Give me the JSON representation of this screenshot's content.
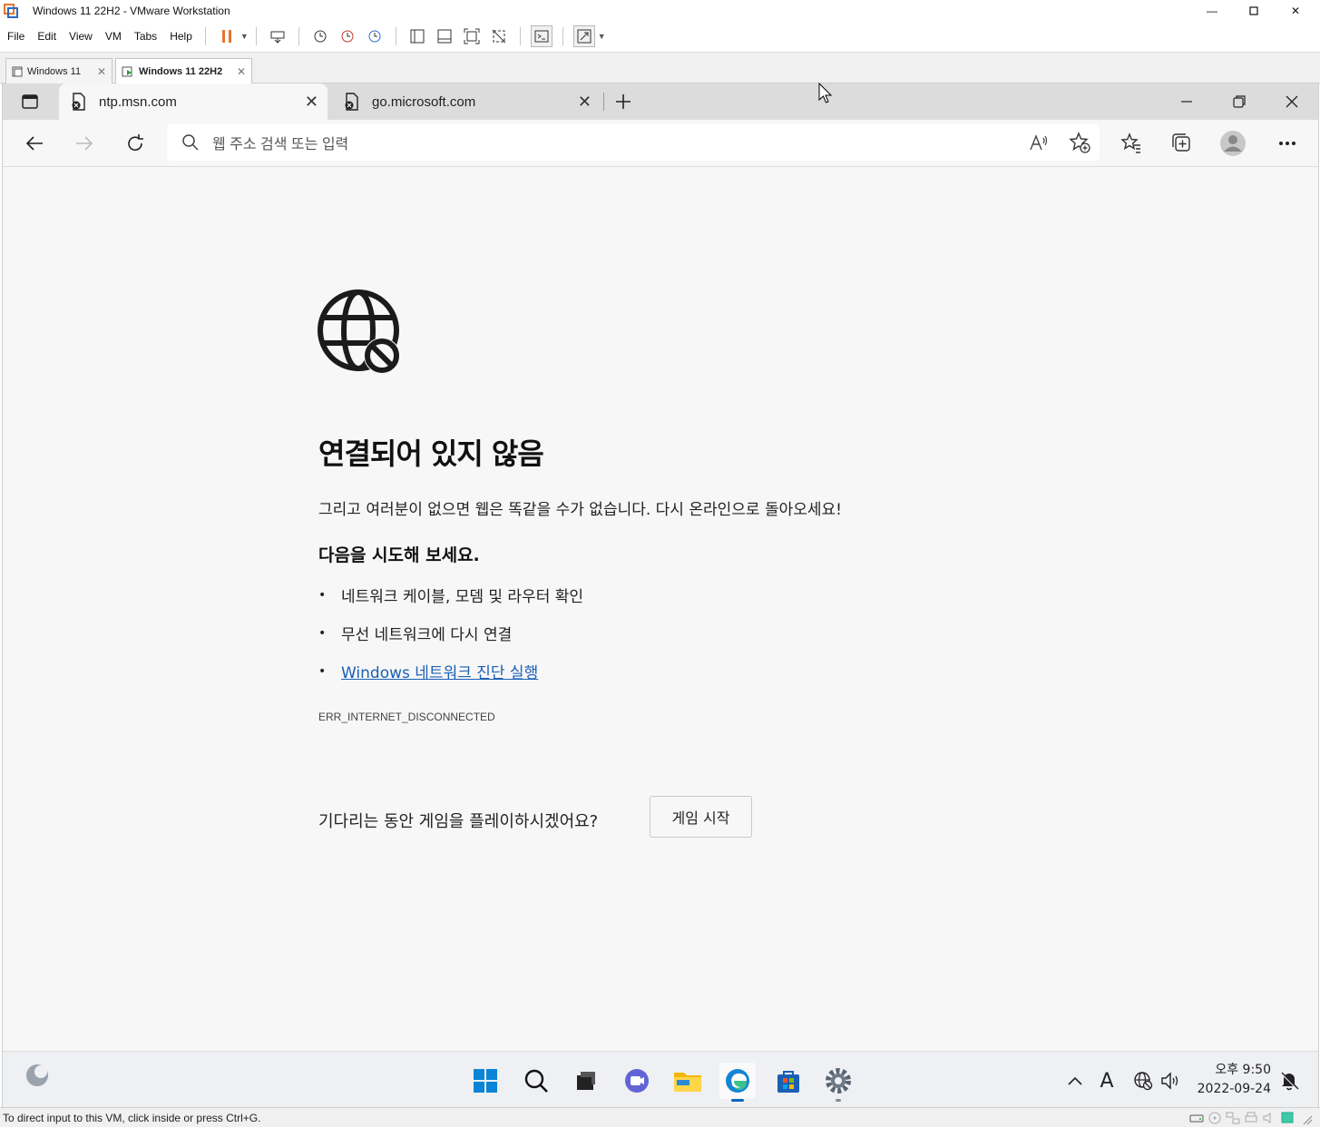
{
  "vmware": {
    "title": "Windows 11 22H2 - VMware Workstation",
    "menu": [
      "File",
      "Edit",
      "View",
      "VM",
      "Tabs",
      "Help"
    ],
    "tabs": [
      {
        "label": "Windows 11",
        "active": false
      },
      {
        "label": "Windows 11 22H2",
        "active": true
      }
    ],
    "status_text": "To direct input to this VM, click inside or press Ctrl+G."
  },
  "edge": {
    "tabs": [
      {
        "label": "ntp.msn.com",
        "active": true
      },
      {
        "label": "go.microsoft.com",
        "active": false
      }
    ],
    "address_placeholder": "웹 주소 검색 또는 입력"
  },
  "error_page": {
    "heading": "연결되어 있지 않음",
    "description": "그리고 여러분이 없으면 웹은 똑같을 수가 없습니다. 다시 온라인으로 돌아오세요!",
    "try_heading": "다음을 시도해 보세요.",
    "suggestions": [
      "네트워크 케이블, 모뎀 및 라우터 확인",
      "무선 네트워크에 다시 연결"
    ],
    "diagnostics_link": "Windows 네트워크 진단 실행",
    "error_code": "ERR_INTERNET_DISCONNECTED",
    "game_prompt": "기다리는 동안 게임을 플레이하시겠어요?",
    "game_button": "게임 시작"
  },
  "taskbar": {
    "time": "오후 9:50",
    "date": "2022-09-24",
    "input_indicator": "A"
  },
  "colors": {
    "accent": "#0067c0",
    "link": "#1a5fb4",
    "page_bg": "#f7f7f7",
    "pause_orange": "#e8742c"
  }
}
